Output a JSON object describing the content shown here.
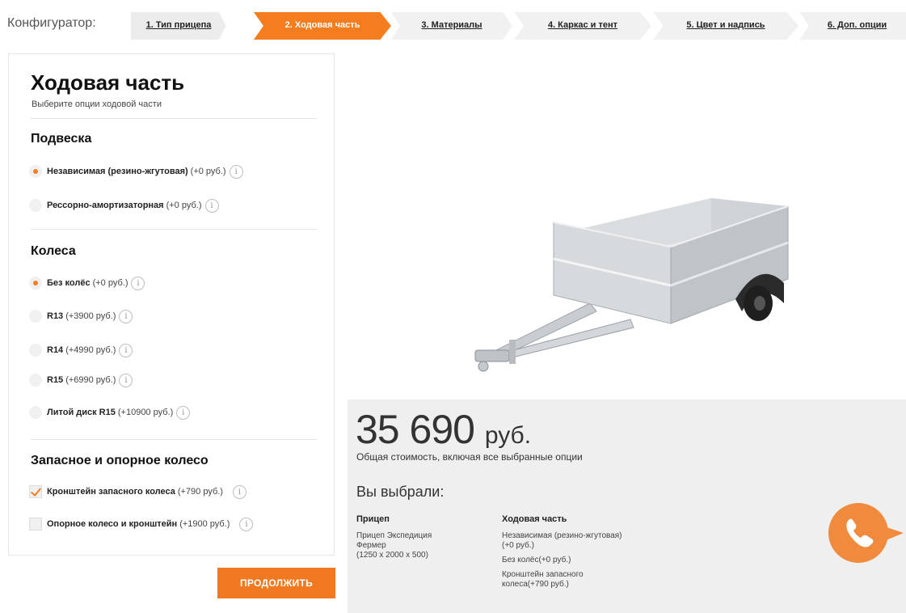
{
  "configurator": {
    "label": "Конфигуратор:",
    "steps": [
      {
        "label": "1. Тип прицепа",
        "state": "done"
      },
      {
        "label": "2. Ходовая часть",
        "state": "active"
      },
      {
        "label": "3. Материалы",
        "state": "next"
      },
      {
        "label": "4. Каркас и тент",
        "state": "next"
      },
      {
        "label": "5. Цвет и надпись",
        "state": "next"
      },
      {
        "label": "6. Доп. опции",
        "state": "next"
      }
    ]
  },
  "panel": {
    "title": "Ходовая часть",
    "subtitle": "Выберите опции ходовой части",
    "suspension": {
      "title": "Подвеска",
      "options": [
        {
          "name": "Независимая (резино-жгутовая)",
          "price": "(+0 руб.)",
          "selected": true
        },
        {
          "name": "Рессорно-амортизаторная",
          "price": "(+0 руб.)",
          "selected": false
        }
      ]
    },
    "wheels": {
      "title": "Колеса",
      "options": [
        {
          "name": "Без колёс",
          "price": "(+0 руб.)",
          "selected": true
        },
        {
          "name": "R13",
          "price": "(+3900 руб.)",
          "selected": false
        },
        {
          "name": "R14",
          "price": "(+4990 руб.)",
          "selected": false
        },
        {
          "name": "R15",
          "price": "(+6990 руб.)",
          "selected": false
        },
        {
          "name": "Литой диск R15",
          "price": "(+10900 руб.)",
          "selected": false
        }
      ]
    },
    "spare": {
      "title": "Запасное и опорное колесо",
      "options": [
        {
          "name": "Кронштейн запасного колеса",
          "price": "(+790 руб.)",
          "checked": true
        },
        {
          "name": "Опорное колесо и кронштейн",
          "price": "(+1900 руб.)",
          "checked": false
        }
      ]
    },
    "info_glyph": "i"
  },
  "continue_label": "ПРОДОЛЖИТЬ",
  "summary": {
    "price": "35 690",
    "currency": "руб.",
    "note": "Общая стоимость, включая все выбранные опции",
    "chosen_title": "Вы выбрали:",
    "trailer": {
      "heading": "Прицеп",
      "lines": [
        "Прицеп Экспедиция Фермер",
        "(1250 x 2000 x 500)"
      ]
    },
    "chassis": {
      "heading": "Ходовая часть",
      "lines": [
        "Независимая (резино-жгутовая)(+0 руб.)",
        "Без колёс(+0 руб.)",
        "Кронштейн запасного колеса(+790 руб.)"
      ]
    }
  },
  "colors": {
    "accent": "#f47d20",
    "summary_bg": "#efefef"
  },
  "icons": {
    "phone": "phone-icon",
    "info": "info-icon",
    "trailer": "trailer-image"
  }
}
